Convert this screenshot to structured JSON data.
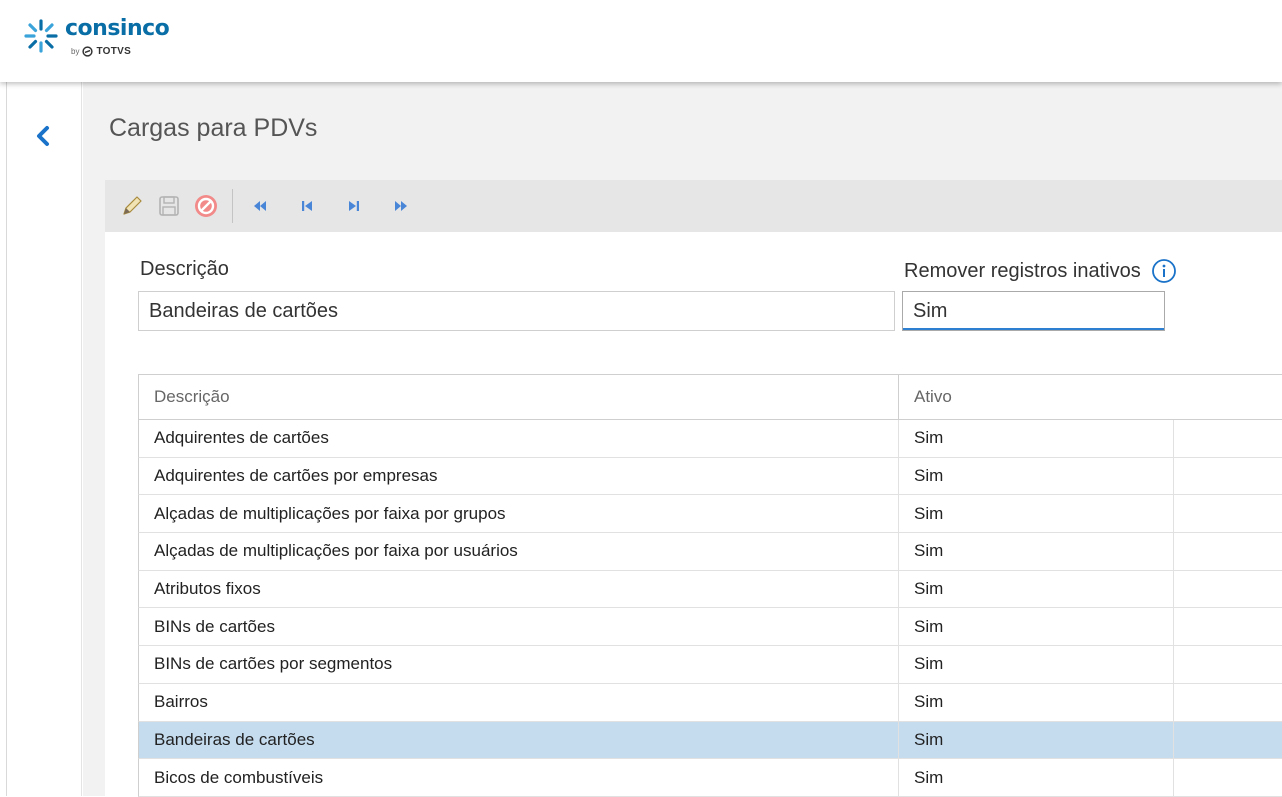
{
  "brand": {
    "name": "consinco",
    "by": "by",
    "partner": "TOTVS",
    "primary_color": "#0a6ea6",
    "accent_color": "#3aa3d9"
  },
  "nav": {
    "back_icon": "chevron-left-icon"
  },
  "page": {
    "title": "Cargas para PDVs"
  },
  "toolbar": {
    "edit_icon": "pencil-icon",
    "save_icon": "floppy-disk-icon",
    "cancel_icon": "prohibited-icon",
    "first_icon": "double-chevron-left-icon",
    "prev_icon": "skip-back-icon",
    "next_icon": "skip-forward-icon",
    "last_icon": "double-chevron-right-icon"
  },
  "form": {
    "descricao_label": "Descrição",
    "descricao_value": "Bandeiras de cartões",
    "remover_label": "Remover registros inativos",
    "remover_value": "Sim",
    "info_icon": "info-icon"
  },
  "grid": {
    "columns": [
      "Descrição",
      "Ativo"
    ],
    "rows": [
      {
        "descricao": "Adquirentes de cartões",
        "ativo": "Sim"
      },
      {
        "descricao": "Adquirentes de cartões por empresas",
        "ativo": "Sim"
      },
      {
        "descricao": "Alçadas de multiplicações por faixa por grupos",
        "ativo": "Sim"
      },
      {
        "descricao": "Alçadas de multiplicações por faixa por usuários",
        "ativo": "Sim"
      },
      {
        "descricao": "Atributos fixos",
        "ativo": "Sim"
      },
      {
        "descricao": "BINs de cartões",
        "ativo": "Sim"
      },
      {
        "descricao": "BINs de cartões por segmentos",
        "ativo": "Sim"
      },
      {
        "descricao": "Bairros",
        "ativo": "Sim"
      },
      {
        "descricao": "Bandeiras de cartões",
        "ativo": "Sim",
        "selected": true
      },
      {
        "descricao": "Bicos de combustíveis",
        "ativo": "Sim"
      }
    ],
    "selected_color": "#c5dcef"
  }
}
